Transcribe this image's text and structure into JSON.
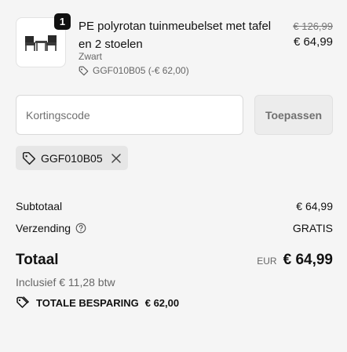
{
  "line_item": {
    "quantity": "1",
    "name": "PE polyrotan tuinmeubelset met tafel en 2 stoelen",
    "variant": "Zwart",
    "discount": "GGF010B05 (-€ 62,00)",
    "original_price": "€ 126,99",
    "price": "€ 64,99"
  },
  "discount_form": {
    "placeholder": "Kortingscode",
    "value": "",
    "apply_label": "Toepassen"
  },
  "applied_code": "GGF010B05",
  "summary": {
    "subtotal_label": "Subtotaal",
    "subtotal_value": "€ 64,99",
    "shipping_label": "Verzending",
    "shipping_value": "GRATIS",
    "total_label": "Totaal",
    "currency": "EUR",
    "total_value": "€ 64,99",
    "tax_note": "Inclusief € 11,28 btw",
    "savings_label": "TOTALE BESPARING",
    "savings_value": "€ 62,00"
  },
  "icons": {
    "tag": "tag-icon",
    "remove": "close-icon",
    "help": "question-circle-icon",
    "savings": "price-tags-icon"
  }
}
